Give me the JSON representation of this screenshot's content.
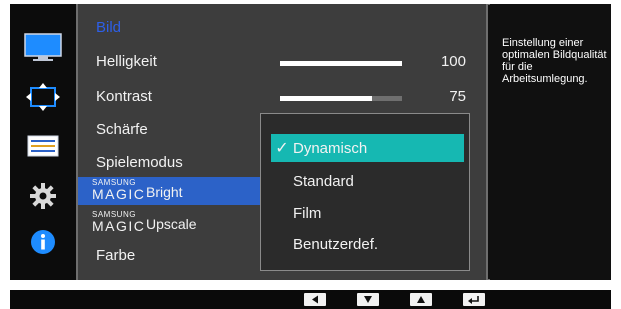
{
  "sidebar": {
    "icons": [
      "picture-icon",
      "screen-adjust-icon",
      "system-settings-icon",
      "gear-icon",
      "info-icon"
    ],
    "active_color": "#1e8cff"
  },
  "menu": {
    "title": "Bild",
    "items": [
      {
        "label": "Helligkeit",
        "value": "100",
        "level": 1.0
      },
      {
        "label": "Kontrast",
        "value": "75",
        "level": 0.75
      },
      {
        "label": "Schärfe"
      },
      {
        "label": "Spielemodus"
      }
    ],
    "magic_bright": {
      "brand_top": "SAMSUNG",
      "brand": "MAGIC",
      "feature": "Bright"
    },
    "magic_upscale": {
      "brand_top": "SAMSUNG",
      "brand": "MAGIC",
      "feature": "Upscale"
    },
    "last_item": "Farbe"
  },
  "dropdown": {
    "options": [
      "Dynamisch",
      "Standard",
      "Film",
      "Benutzerdef."
    ],
    "selected": "Dynamisch",
    "check_glyph": "✓"
  },
  "info": {
    "text": "Einstellung einer optimalen Bildqualität für die Arbeitsumlegung."
  },
  "controls": {
    "buttons": [
      "left-arrow-icon",
      "down-arrow-icon",
      "up-arrow-icon",
      "enter-icon"
    ]
  },
  "colors": {
    "highlight_blue": "#2c62c8",
    "selected_teal": "#16b8b2",
    "title_blue": "#2d5fe8"
  }
}
